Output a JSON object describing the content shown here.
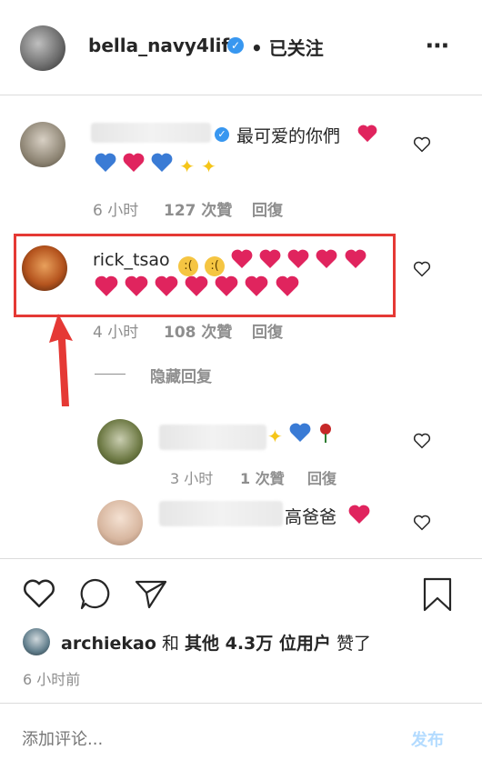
{
  "header": {
    "username": "bella_navy4life",
    "follow_status": "• 已关注",
    "more_icon": "more-icon"
  },
  "comments": [
    {
      "text": "最可爱的你們",
      "emojis_line2": "blue-heart, heart, blue-heart, sparkles, sparkles",
      "time": "6 小时",
      "likes": "127 次贊",
      "reply": "回復"
    },
    {
      "username": "rick_tsao",
      "time": "4 小时",
      "likes": "108 次贊",
      "reply": "回復",
      "hide_replies": "隐藏回复"
    }
  ],
  "replies": [
    {
      "time": "3 小时",
      "likes": "1 次贊",
      "reply": "回復"
    },
    {
      "text": "高爸爸"
    }
  ],
  "likes_line": {
    "user": "archiekao",
    "and": "和",
    "others": "其他 4.3万 位用户",
    "liked": "赞了"
  },
  "timestamp": "6 小时前",
  "comment_input": {
    "placeholder": "添加评论...",
    "post_label": "发布"
  },
  "colors": {
    "highlight_border": "#e53935",
    "arrow": "#e53935",
    "verified": "#3897f0",
    "post_link": "#b3dbff",
    "heart_red": "#e0245e"
  }
}
